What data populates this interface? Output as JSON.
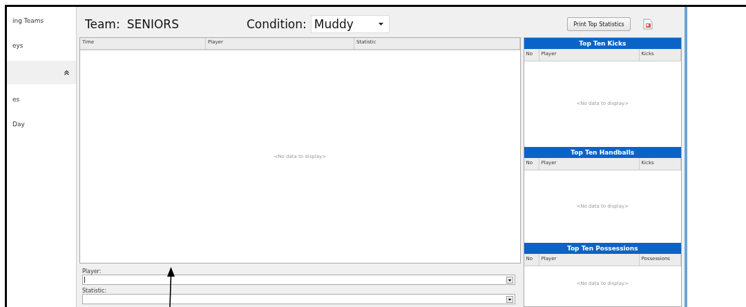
{
  "sidebar": {
    "items": [
      {
        "label": "ing Teams",
        "kind": "item"
      },
      {
        "label": "eys",
        "kind": "item"
      },
      {
        "kind": "group",
        "expanded": true
      },
      {
        "label": "es",
        "kind": "item"
      },
      {
        "label": "Day",
        "kind": "item"
      }
    ]
  },
  "header": {
    "team_label": "Team:",
    "team_value": "SENIORS",
    "condition_label": "Condition:",
    "condition_value": "Muddy",
    "print_button": "Print Top Statistics"
  },
  "grid": {
    "columns": [
      "Time",
      "Player",
      "Statistic"
    ],
    "empty_text": "<No data to display>"
  },
  "entry": {
    "player_label": "Player:",
    "statistic_label": "Statistic:"
  },
  "panels": [
    {
      "title": "Top Ten Kicks",
      "columns": [
        "No",
        "Player",
        "Kicks"
      ],
      "empty_text": "<No data to display>"
    },
    {
      "title": "Top Ten Handballs",
      "columns": [
        "No",
        "Player",
        "Kicks"
      ],
      "empty_text": "<No data to display>"
    },
    {
      "title": "Top Ten Possessions",
      "columns": [
        "No",
        "Player",
        "Possessions"
      ],
      "empty_text": "<No data to display>"
    }
  ]
}
